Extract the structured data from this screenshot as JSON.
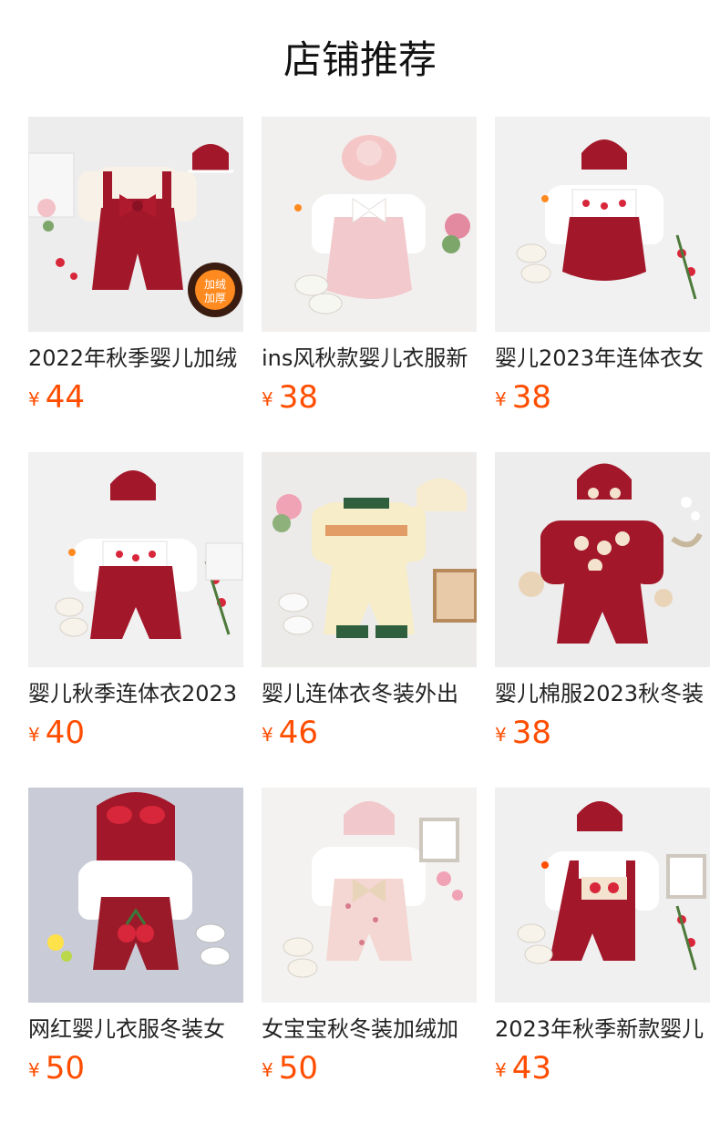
{
  "section": {
    "title": "店铺推荐"
  },
  "colors": {
    "price": "#ff4d00",
    "title": "#111111"
  },
  "products": [
    {
      "name": "2022年秋季婴儿加绒",
      "currency": "¥",
      "price": "44",
      "badge": "加绒加厚",
      "theme": "red-bow"
    },
    {
      "name": "ins风秋款婴儿衣服新",
      "currency": "¥",
      "price": "38",
      "theme": "pink-bow"
    },
    {
      "name": "婴儿2023年连体衣女",
      "currency": "¥",
      "price": "38",
      "theme": "red-romper-bib"
    },
    {
      "name": "婴儿秋季连体衣2023",
      "currency": "¥",
      "price": "40",
      "theme": "red-bib-jumpsuit"
    },
    {
      "name": "婴儿连体衣冬装外出",
      "currency": "¥",
      "price": "46",
      "theme": "cream-knit"
    },
    {
      "name": "婴儿棉服2023秋冬装",
      "currency": "¥",
      "price": "38",
      "theme": "red-bears"
    },
    {
      "name": "网红婴儿衣服冬装女",
      "currency": "¥",
      "price": "50",
      "theme": "red-cherry-hood"
    },
    {
      "name": "女宝宝秋冬装加绒加",
      "currency": "¥",
      "price": "50",
      "theme": "floral-pink"
    },
    {
      "name": "2023年秋季新款婴儿",
      "currency": "¥",
      "price": "43",
      "theme": "red-dragon"
    }
  ]
}
